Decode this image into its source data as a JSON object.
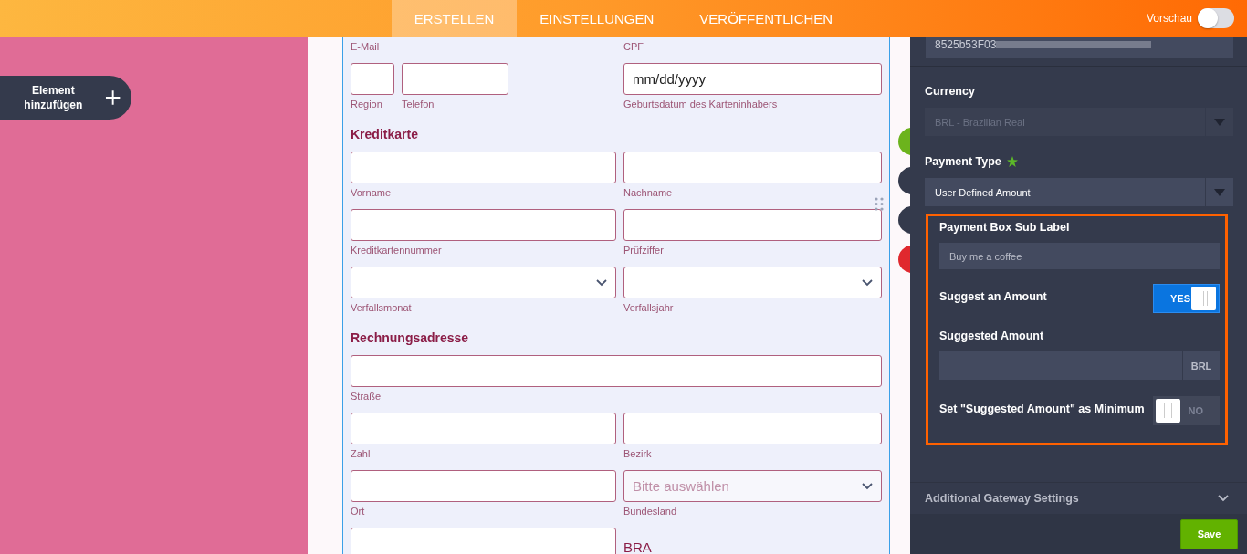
{
  "top_bar": {
    "tabs": [
      {
        "label": "ERSTELLEN",
        "selected": true
      },
      {
        "label": "EINSTELLUNGEN",
        "selected": false
      },
      {
        "label": "VERÖFFENTLICHEN",
        "selected": false
      }
    ],
    "preview": {
      "label": "Vorschau",
      "on": false
    }
  },
  "add_element_button": {
    "label": "Element hinzufügen"
  },
  "form": {
    "rows": [
      {
        "kind": "fields",
        "fields": [
          {
            "kind": "input",
            "label": "E-Mail"
          },
          {
            "kind": "input",
            "label": "CPF"
          }
        ]
      },
      {
        "kind": "fields",
        "fields": [
          {
            "kind": "group",
            "fields": [
              {
                "kind": "input",
                "label": "Region"
              },
              {
                "kind": "input",
                "label": "Telefon"
              }
            ]
          },
          {
            "kind": "input",
            "label": "Geburtsdatum des Karteninhabers",
            "placeholder": "mm/dd/yyyy"
          }
        ]
      },
      {
        "kind": "heading",
        "text": "Kreditkarte"
      },
      {
        "kind": "fields",
        "fields": [
          {
            "kind": "input",
            "label": "Vorname"
          },
          {
            "kind": "input",
            "label": "Nachname"
          }
        ]
      },
      {
        "kind": "fields",
        "fields": [
          {
            "kind": "input",
            "label": "Kreditkartennummer"
          },
          {
            "kind": "input",
            "label": "Prüfziffer"
          }
        ]
      },
      {
        "kind": "fields",
        "fields": [
          {
            "kind": "select",
            "label": "Verfallsmonat"
          },
          {
            "kind": "select",
            "label": "Verfallsjahr"
          }
        ]
      },
      {
        "kind": "heading",
        "text": "Rechnungsadresse"
      },
      {
        "kind": "fields",
        "fields": [
          {
            "kind": "input",
            "label": "Straße"
          }
        ]
      },
      {
        "kind": "fields",
        "fields": [
          {
            "kind": "input",
            "label": "Zahl"
          },
          {
            "kind": "input",
            "label": "Bezirk"
          }
        ]
      },
      {
        "kind": "fields",
        "fields": [
          {
            "kind": "input",
            "label": "Ort"
          },
          {
            "kind": "select",
            "label": "Bundesland",
            "placeholder": "Bitte auswählen"
          }
        ]
      },
      {
        "kind": "fields",
        "fields": [
          {
            "kind": "input"
          },
          {
            "kind": "text",
            "text": "BRA"
          }
        ]
      }
    ]
  },
  "floating_actions": [
    {
      "color": "#6cb31d"
    },
    {
      "color": "#343a4c"
    },
    {
      "color": "#343a4c"
    },
    {
      "color": "#e0282e"
    }
  ],
  "settings_panel": {
    "top_field": {
      "value": "8525b53F03"
    },
    "fields": [
      {
        "kind": "select",
        "label": "Currency",
        "value": "BRL - Brazilian Real",
        "disabled": true
      },
      {
        "kind": "select",
        "label": "Payment Type",
        "value": "User Defined Amount",
        "disabled": false,
        "required": true
      }
    ],
    "highlighted": [
      {
        "kind": "text",
        "label": "Payment Box Sub Label",
        "placeholder": "Buy me a coffee"
      },
      {
        "kind": "toggle",
        "label": "Suggest an Amount",
        "on": true,
        "text": "YES"
      },
      {
        "kind": "amount",
        "label": "Suggested Amount",
        "addon": "BRL"
      },
      {
        "kind": "toggle",
        "label": "Set \"Suggested Amount\" as Minimum",
        "on": false,
        "text": "NO"
      }
    ],
    "section": {
      "label": "Additional Gateway Settings",
      "expanded": false
    },
    "save_button": "Save"
  }
}
